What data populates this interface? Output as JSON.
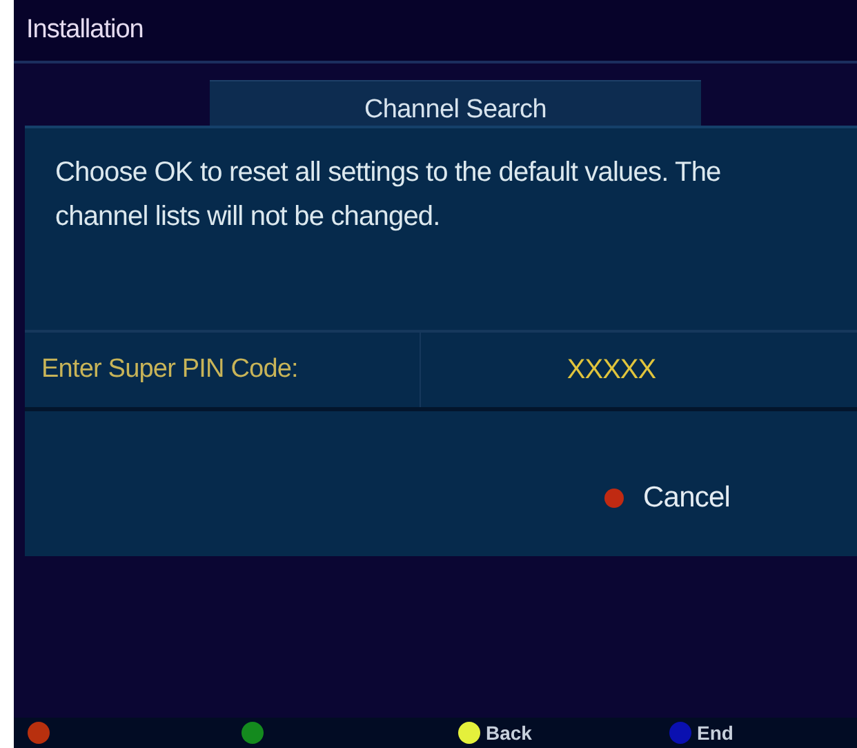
{
  "header": {
    "title": "Installation"
  },
  "menu_item": {
    "label": "Channel Search"
  },
  "dialog": {
    "message": "Choose OK to reset all settings to the default values. The channel lists will not be changed.",
    "pin_label": "Enter Super PIN Code:",
    "pin_value": "XXXXX",
    "buttons": [
      {
        "label": "Cancel",
        "color": "#c02a12"
      }
    ]
  },
  "footer": {
    "keys": [
      {
        "color": "#b8300e"
      },
      {
        "color": "#148a1e"
      },
      {
        "color": "#e4f03c",
        "label": "Back"
      },
      {
        "color": "#0a10b0",
        "label": "End"
      }
    ]
  }
}
